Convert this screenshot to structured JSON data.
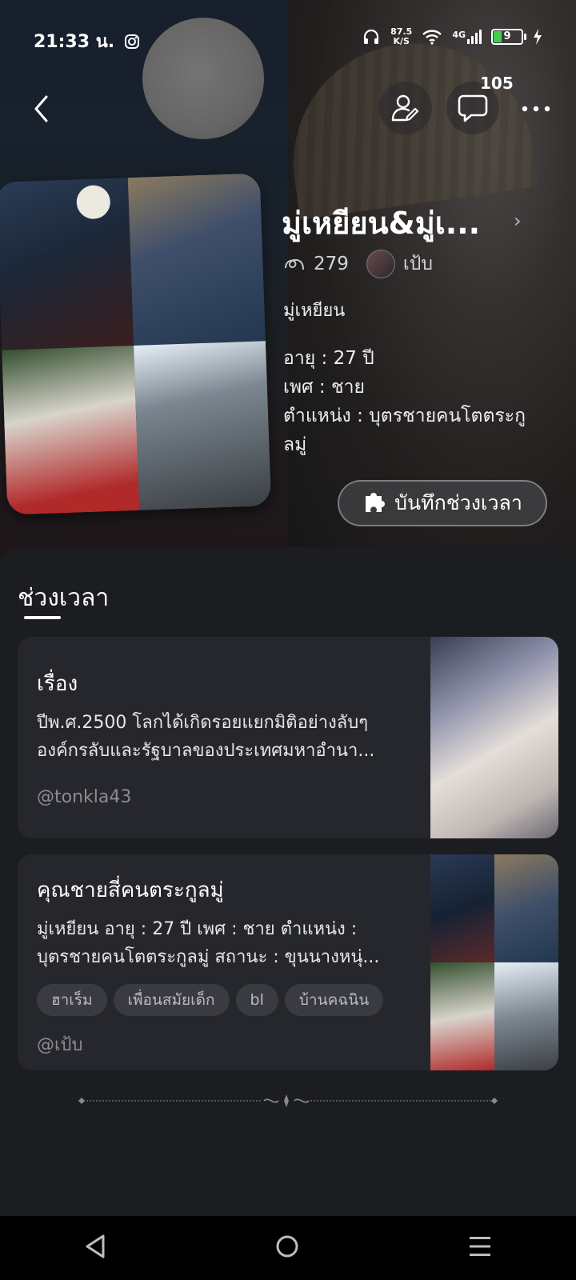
{
  "status_bar": {
    "time": "21:33 น.",
    "net_speed_value": "87.5",
    "net_speed_unit": "K/S",
    "network": "4G",
    "battery": "9"
  },
  "header": {
    "chat_count": "105"
  },
  "character": {
    "title": "มู่เหยียน&มู่เ...",
    "views": "279",
    "creator": "เป้บ",
    "name": "มู่เหยียน",
    "bio": [
      "อายุ : 27 ปี",
      "เพศ : ชาย",
      "ตำแหน่ง : บุตรชายคนโตตระกู",
      "ลมู่"
    ],
    "save_button": "บันทึกช่วงเวลา"
  },
  "section": {
    "title": "ช่วงเวลา"
  },
  "cards": [
    {
      "title": "เรื่อง",
      "desc": [
        "ปีพ.ศ.2500 โลกได้เกิดรอยแยกมิติอย่างลับๆ",
        "องค์กรลับและรัฐบาลของประเทศมหาอำนา..."
      ],
      "author": "@tonkla43"
    },
    {
      "title": "คุณชายสี่คนตระกูลมู่",
      "desc": [
        "มู่เหยียน อายุ : 27 ปี เพศ : ชาย ตำแหน่ง :",
        "บุตรชายคนโตตระกูลมู่ สถานะ : ขุนนางหนุ่..."
      ],
      "tags": [
        "ฮาเร็ม",
        "เพื่อนสมัยเด็ก",
        "bl",
        "บ้านคฉนิน"
      ],
      "author": "@เป้บ"
    }
  ],
  "icons": {
    "back": "back-arrow-icon",
    "edit_profile": "person-edit-icon",
    "chat": "chat-bubble-icon",
    "more": "more-dots-icon",
    "views": "views-icon",
    "save": "puzzle-icon"
  }
}
